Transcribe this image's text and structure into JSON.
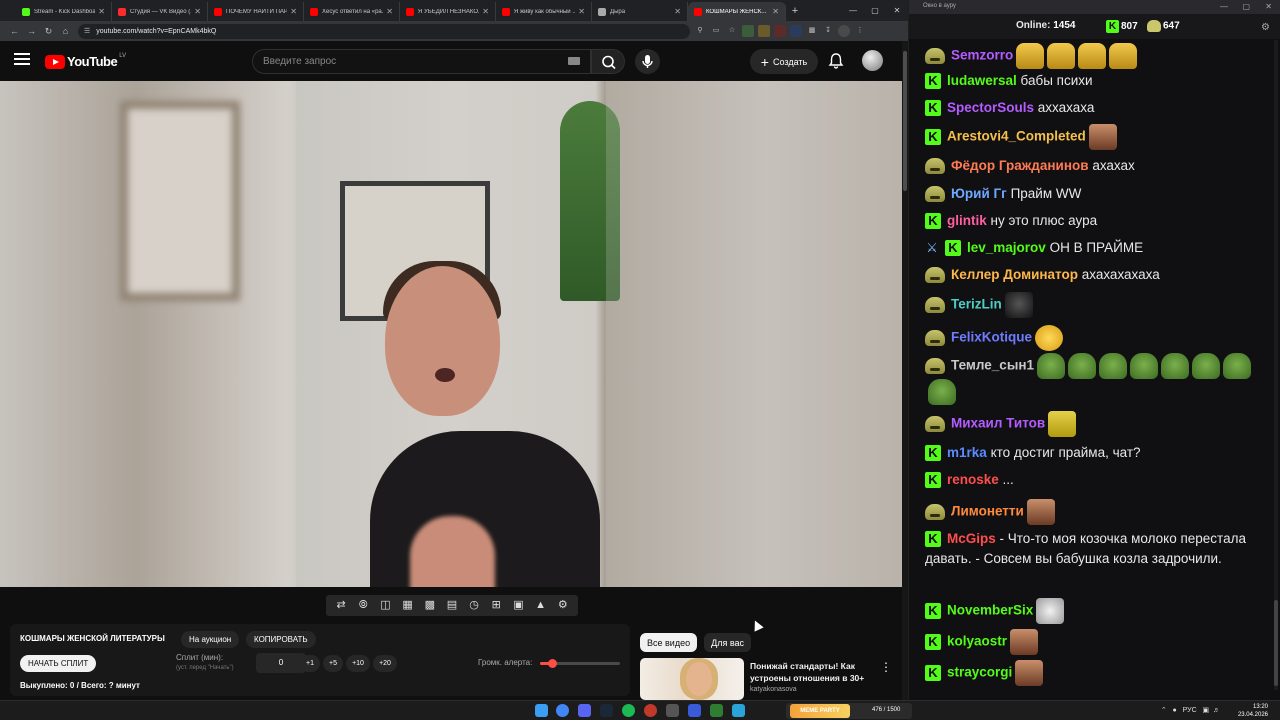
{
  "browser": {
    "tabs": [
      {
        "title": "Stream - Kick Dashboa...",
        "color": "#53fc18",
        "active": false
      },
      {
        "title": "Студия — VK Видео (... ",
        "color": "#ff2a2a",
        "active": false
      },
      {
        "title": "ПОЧЕМУ НАЙТИ ПАР...",
        "color": "#ff0000",
        "active": false
      },
      {
        "title": "Хесус ответил на «ра...",
        "color": "#ff0000",
        "active": false
      },
      {
        "title": "Я УБЕДИЛ НЕЗНАКО...",
        "color": "#ff0000",
        "active": false
      },
      {
        "title": "Я живу как обычный ...",
        "color": "#ff0000",
        "active": false
      },
      {
        "title": "Дыра",
        "color": "#aaaaaa",
        "active": false
      },
      {
        "title": "КОШМАРЫ ЖЕНСК...",
        "color": "#ff0000",
        "active": true
      }
    ],
    "url": "youtube.com/watch?v=EpnCAMk4bkQ"
  },
  "youtube": {
    "logo_text": "YouTube",
    "country_code": "LV",
    "search_placeholder": "Введите запрос",
    "create_label": "Создать"
  },
  "auction": {
    "title": "КОШМАРЫ ЖЕНСКОЙ ЛИТЕРАТУРЫ",
    "on_auction_label": "На аукцион",
    "copy_label": "КОПИРОВАТЬ",
    "start_split_label": "НАЧАТЬ СПЛИТ",
    "split_label": "Сплит (мин):",
    "split_hint": "(уст. перед \"Начать\")",
    "split_value": "0",
    "increments": [
      "+1",
      "+5",
      "+10",
      "+20"
    ],
    "volume_label": "Громк. алерта:",
    "volume_level": 0.15,
    "bought_text": "Выкуплено: 0 / Всего: ? минут"
  },
  "recommendations": {
    "chips": [
      "Все видео",
      "Для вас"
    ],
    "video_title": "Понижай стандарты! Как устроены отношения в 30+",
    "channel": "katyakonasova"
  },
  "chat": {
    "window_title": "Окно в ауру",
    "online_label": "Online:",
    "online_count": "1454",
    "stat1": "807",
    "stat2": "647",
    "colors": {
      "kick_green": "#53fc18"
    },
    "messages": [
      {
        "user": "Semzorro",
        "color": "#b45cff",
        "badge": "frog",
        "text": "",
        "emotes": [
          "crown",
          "crown",
          "crown",
          "crown"
        ]
      },
      {
        "user": "ludawersal",
        "color": "#53fc18",
        "badge": "k",
        "text": "бабы психи",
        "emotes": []
      },
      {
        "user": "SpectorSouls",
        "color": "#b45cff",
        "badge": "k",
        "text": "аххахаха",
        "emotes": []
      },
      {
        "user": "Arestovi4_Completed",
        "color": "#f4c04a",
        "badge": "k",
        "text": "",
        "emotes": [
          "face"
        ]
      },
      {
        "user": "Фёдор Гражданинов",
        "color": "#ff7b54",
        "badge": "frog",
        "text": "ахахах",
        "emotes": []
      },
      {
        "user": "Юрий Гг",
        "color": "#6fa8ff",
        "badge": "frog",
        "text": "Прайм WW",
        "emotes": []
      },
      {
        "user": "glintik",
        "color": "#ff5fa2",
        "badge": "k",
        "text": "ну это плюс аура",
        "emotes": []
      },
      {
        "user": "lev_majorov",
        "color": "#53fc18",
        "badge": "sword-k",
        "text": "ОН В ПРАЙМЕ",
        "emotes": []
      },
      {
        "user": "Келлер Доминатор",
        "color": "#ffb74a",
        "badge": "frog",
        "text": "ахахахахаха",
        "emotes": []
      },
      {
        "user": "TerizLin",
        "color": "#4ecdc4",
        "badge": "frog",
        "text": "",
        "emotes": [
          "dark"
        ]
      },
      {
        "user": "FelixKotique",
        "color": "#6f7cff",
        "badge": "frog",
        "text": "",
        "emotes": [
          "gold"
        ]
      },
      {
        "user": "Темле_сын1",
        "color": "#c9c9c9",
        "badge": "frog",
        "text": "",
        "emotes": [
          "pepe",
          "pepe",
          "pepe",
          "pepe",
          "pepe",
          "pepe",
          "pepe",
          "pepe"
        ]
      },
      {
        "user": "Михаил Титов",
        "color": "#b45cff",
        "badge": "frog",
        "text": "",
        "emotes": [
          "yellow"
        ]
      },
      {
        "user": "m1rka",
        "color": "#5b8cff",
        "badge": "k",
        "text": "кто достиг прайма, чат?",
        "emotes": []
      },
      {
        "user": "renoske",
        "color": "#ff4d4d",
        "badge": "k",
        "text": "...",
        "emotes": []
      },
      {
        "user": "Лимонетти",
        "color": "#ff8a3d",
        "badge": "frog",
        "text": "",
        "emotes": [
          "face"
        ]
      },
      {
        "user": "McGips",
        "color": "#ff4d4d",
        "badge": "k",
        "text": "- Что-то моя козочка молоко перестала давать. - Совсем вы бабушка козла задрочили.",
        "emotes": []
      },
      {
        "user": "NovemberSix",
        "color": "#53fc18",
        "badge": "k",
        "text": "",
        "emotes": [
          "white"
        ]
      },
      {
        "user": "kolyaostr",
        "color": "#53fc18",
        "badge": "k",
        "text": "",
        "emotes": [
          "face"
        ]
      },
      {
        "user": "straycorgi",
        "color": "#53fc18",
        "badge": "k",
        "text": "",
        "emotes": [
          "face"
        ]
      }
    ]
  },
  "taskbar": {
    "widget_label": "MEME PARTY",
    "widget_count": "476 / 1500",
    "lang": "РУС",
    "time": "13:20",
    "date": "23.04.2026"
  }
}
